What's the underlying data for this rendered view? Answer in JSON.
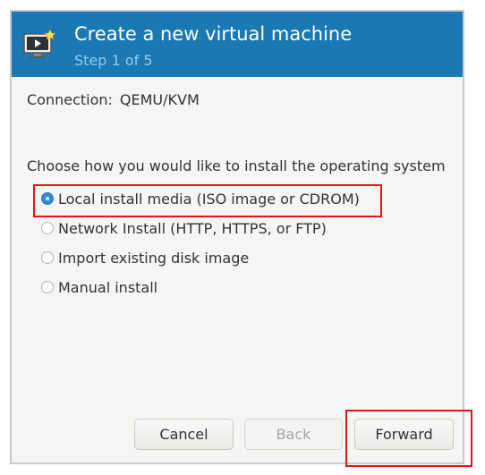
{
  "header": {
    "title": "Create a new virtual machine",
    "step": "Step 1 of 5",
    "icon": "vm-monitor-icon",
    "color": "#1a78b3"
  },
  "connection": {
    "label": "Connection:",
    "value": "QEMU/KVM"
  },
  "install": {
    "question": "Choose how you would like to install the operating system",
    "options": [
      {
        "label": "Local install media (ISO image or CDROM)",
        "selected": true
      },
      {
        "label": "Network Install (HTTP, HTTPS, or FTP)",
        "selected": false
      },
      {
        "label": "Import existing disk image",
        "selected": false
      },
      {
        "label": "Manual install",
        "selected": false
      }
    ]
  },
  "buttons": {
    "cancel": "Cancel",
    "back": "Back",
    "forward": "Forward",
    "back_enabled": false
  },
  "highlight_color": "#e31414"
}
